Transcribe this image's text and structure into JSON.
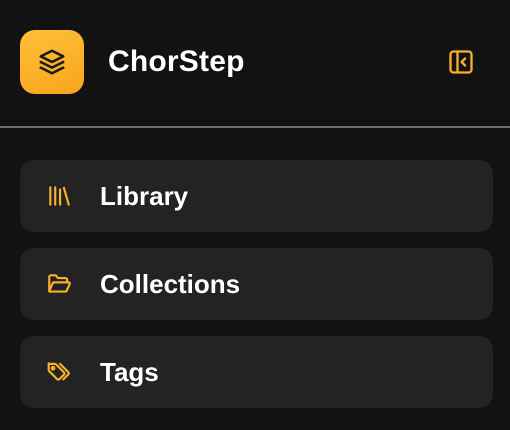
{
  "app": {
    "name": "ChorStep",
    "logo_icon": "layers-icon",
    "collapse_icon": "sidebar-collapse-icon"
  },
  "nav": {
    "items": [
      {
        "label": "Library",
        "icon": "library-icon"
      },
      {
        "label": "Collections",
        "icon": "folder-icon"
      },
      {
        "label": "Tags",
        "icon": "tags-icon"
      }
    ]
  },
  "colors": {
    "background": "#121212",
    "item_background": "#232323",
    "accent": "#f7b12a",
    "divider": "#6d6d6d",
    "text": "#ffffff"
  }
}
